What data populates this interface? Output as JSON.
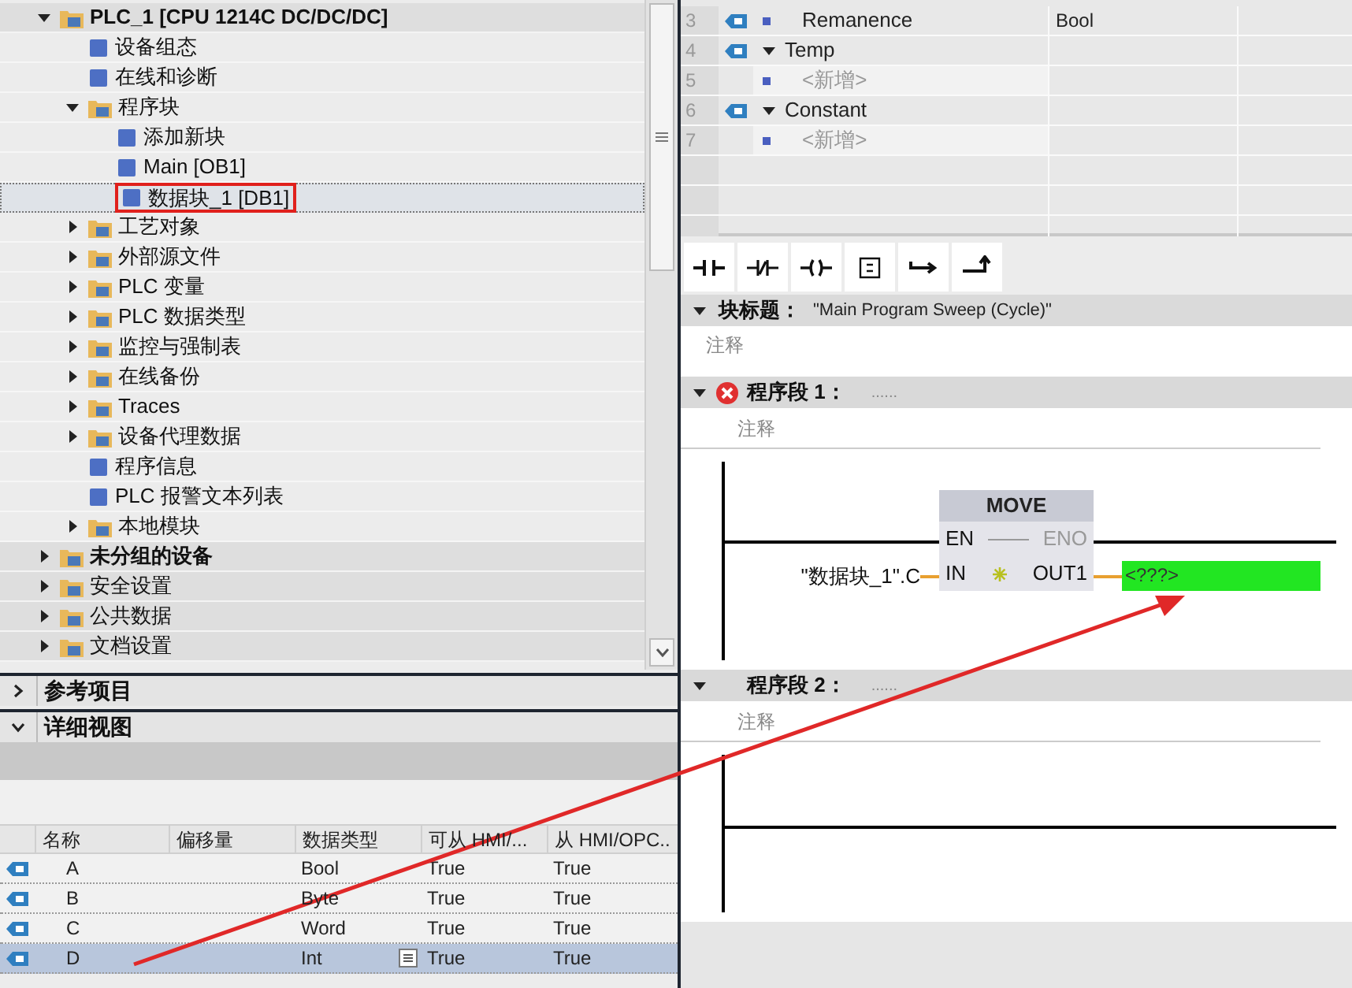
{
  "project_tree": {
    "items": [
      {
        "label": "PLC_1 [CPU 1214C DC/DC/DC]",
        "bold": true,
        "expanded": true,
        "selected": false,
        "children": [
          {
            "label": "设备组态",
            "selected": false
          },
          {
            "label": "在线和诊断",
            "selected": false
          },
          {
            "label": "程序块",
            "expanded": true,
            "selected": false,
            "children": [
              {
                "label": "添加新块",
                "selected": false
              },
              {
                "label": "Main [OB1]",
                "selected": false
              },
              {
                "label": "数据块_1 [DB1]",
                "selected": true,
                "highlighted": true
              }
            ]
          },
          {
            "label": "工艺对象",
            "expanded": false,
            "selected": false
          },
          {
            "label": "外部源文件",
            "expanded": false,
            "selected": false
          },
          {
            "label": "PLC 变量",
            "expanded": false,
            "selected": false
          },
          {
            "label": "PLC 数据类型",
            "expanded": false,
            "selected": false
          },
          {
            "label": "监控与强制表",
            "expanded": false,
            "selected": false
          },
          {
            "label": "在线备份",
            "expanded": false,
            "selected": false
          },
          {
            "label": "Traces",
            "expanded": false,
            "selected": false
          },
          {
            "label": "设备代理数据",
            "expanded": false,
            "selected": false
          },
          {
            "label": "程序信息",
            "selected": false
          },
          {
            "label": "PLC 报警文本列表",
            "selected": false
          },
          {
            "label": "本地模块",
            "expanded": false,
            "selected": false
          }
        ]
      },
      {
        "label": "未分组的设备",
        "bold": true,
        "expanded": false,
        "selected": false
      },
      {
        "label": "安全设置",
        "expanded": false,
        "selected": false
      },
      {
        "label": "公共数据",
        "expanded": false,
        "selected": false
      },
      {
        "label": "文档设置",
        "expanded": false,
        "selected": false
      }
    ]
  },
  "panels": [
    {
      "title": "参考项目",
      "expanded": false
    },
    {
      "title": "详细视图",
      "expanded": true
    }
  ],
  "details_table": {
    "columns": [
      "名称",
      "偏移量",
      "数据类型",
      "可从 HMI/...",
      "从 HMI/OPC.."
    ],
    "rows": [
      {
        "name": "A",
        "offset": "",
        "type": "Bool",
        "col_4": "True",
        "col_5": "True",
        "selected": false
      },
      {
        "name": "B",
        "offset": "",
        "type": "Byte",
        "col_4": "True",
        "col_5": "True",
        "selected": false
      },
      {
        "name": "C",
        "offset": "",
        "type": "Word",
        "col_4": "True",
        "col_5": "True",
        "selected": false
      },
      {
        "name": "D",
        "offset": "",
        "type": "Int",
        "col_4": "True",
        "col_5": "True",
        "selected": true
      }
    ]
  },
  "interface_table": {
    "rows": [
      {
        "number": "3",
        "kind": "member",
        "name": "Remanence",
        "type": "Bool"
      },
      {
        "number": "4",
        "kind": "section",
        "name": "Temp",
        "expanded": true
      },
      {
        "number": "5",
        "kind": "placeholder",
        "name": "<新增>"
      },
      {
        "number": "6",
        "kind": "section",
        "name": "Constant",
        "expanded": true
      },
      {
        "number": "7",
        "kind": "placeholder",
        "name": "<新增>"
      }
    ]
  },
  "toolbar": [
    {
      "kind": "no-contact"
    },
    {
      "kind": "nc-contact"
    },
    {
      "kind": "coil"
    },
    {
      "kind": "empty-box"
    },
    {
      "kind": "open-branch"
    },
    {
      "kind": "close-branch"
    }
  ],
  "block_title": {
    "label": "块标题：",
    "value": "\"Main Program Sweep (Cycle)\"",
    "comment": "注释",
    "expanded": true
  },
  "networks": [
    {
      "title": "程序段 1：",
      "dots": "......",
      "error": true,
      "expanded": true,
      "comment": "注释",
      "box": {
        "name": "MOVE",
        "en": "EN",
        "eno": "ENO",
        "in": "IN",
        "out": "OUT1",
        "input": "\"数据块_1\".C",
        "output": "<???>"
      }
    },
    {
      "title": "程序段 2：",
      "dots": "......",
      "error": false,
      "expanded": true,
      "comment": "注释"
    }
  ]
}
